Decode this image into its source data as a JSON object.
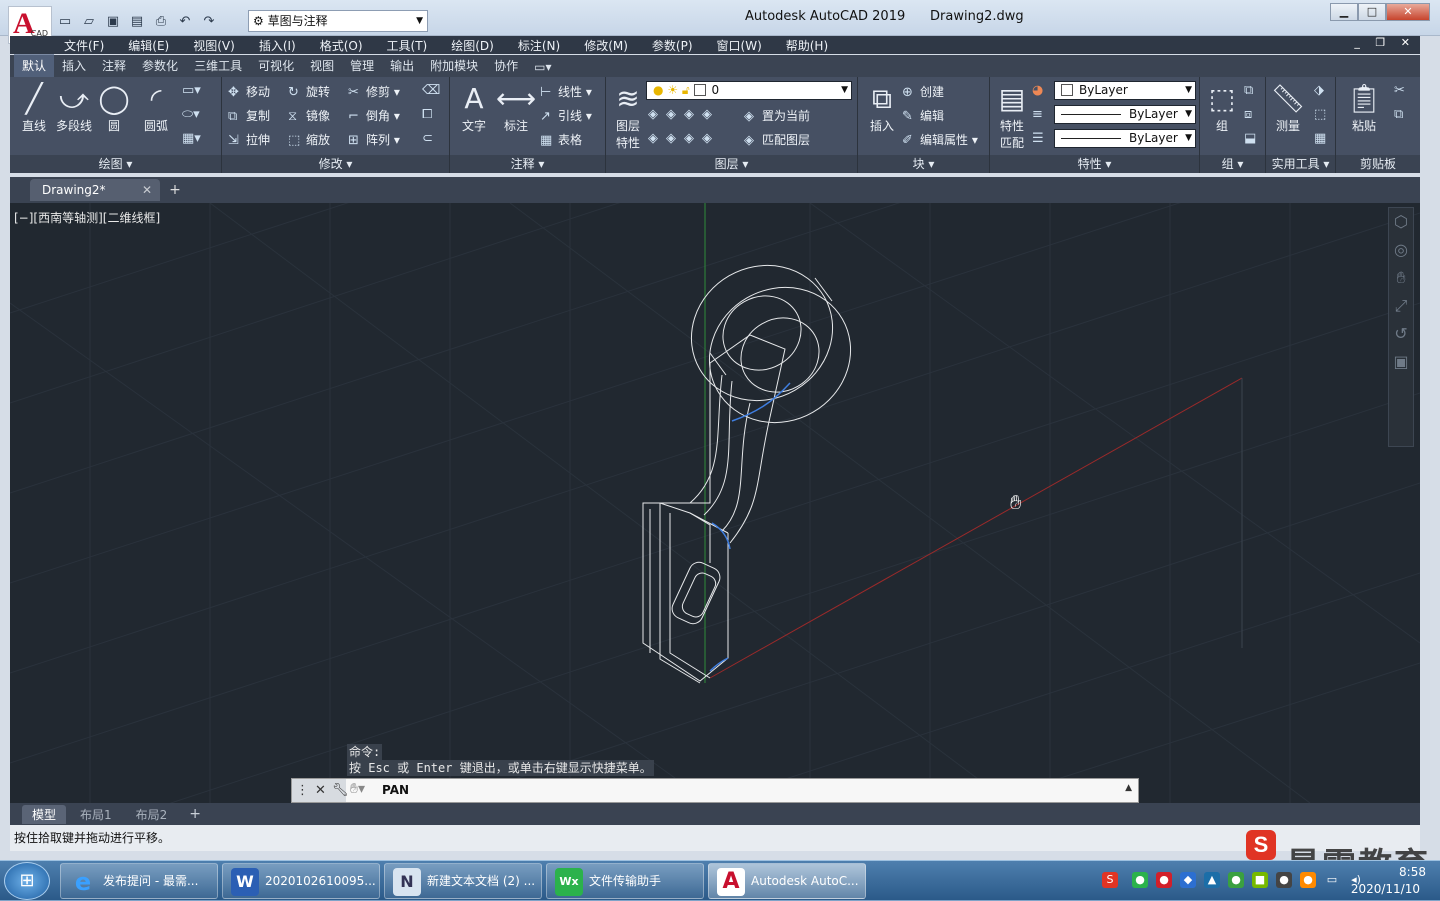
{
  "titlebar": {
    "title": "Autodesk AutoCAD 2019",
    "document": "Drawing2.dwg",
    "workspace": "草图与注释",
    "logo_letter": "A",
    "logo_sub": "CAD"
  },
  "menus": [
    "文件(F)",
    "编辑(E)",
    "视图(V)",
    "插入(I)",
    "格式(O)",
    "工具(T)",
    "绘图(D)",
    "标注(N)",
    "修改(M)",
    "参数(P)",
    "窗口(W)",
    "帮助(H)"
  ],
  "ribbon_tabs": [
    "默认",
    "插入",
    "注释",
    "参数化",
    "三维工具",
    "可视化",
    "视图",
    "管理",
    "输出",
    "附加模块",
    "协作"
  ],
  "ribbon": {
    "draw": {
      "title": "绘图",
      "line": "直线",
      "polyline": "多段线",
      "circle": "圆",
      "arc": "圆弧"
    },
    "modify": {
      "title": "修改",
      "move": "移动",
      "rotate": "旋转",
      "trim": "修剪",
      "copy": "复制",
      "mirror": "镜像",
      "fillet": "倒角",
      "stretch": "拉伸",
      "scale": "缩放",
      "array": "阵列"
    },
    "annotation": {
      "title": "注释",
      "text": "文字",
      "dimension": "标注",
      "linear": "线性",
      "leader": "引线",
      "table": "表格"
    },
    "layers": {
      "title": "图层",
      "layer_props_1": "图层",
      "layer_props_2": "特性",
      "layer_value": "0",
      "set_current": "置为当前",
      "match_layer": "匹配图层"
    },
    "block": {
      "title": "块",
      "insert": "插入",
      "create": "创建",
      "edit": "编辑",
      "edit_attr": "编辑属性"
    },
    "properties": {
      "title": "特性",
      "match_1": "特性",
      "match_2": "匹配",
      "color": "ByLayer",
      "linetype": "ByLayer",
      "lineweight": "ByLayer"
    },
    "groups": {
      "title": "组",
      "group": "组"
    },
    "utilities": {
      "title": "实用工具",
      "measure": "测量"
    },
    "clipboard": {
      "title": "剪贴板",
      "paste": "粘贴"
    }
  },
  "doc_tab": {
    "label": "Drawing2*"
  },
  "viewport": {
    "label": "[−][西南等轴测][二维线框]"
  },
  "command": {
    "history": [
      "命令:",
      "按 Esc 或 Enter 键退出，或单击右键显示快捷菜单。"
    ],
    "input": "PAN"
  },
  "layout_tabs": [
    "模型",
    "布局1",
    "布局2"
  ],
  "status": "按住拾取键并拖动进行平移。",
  "watermark": {
    "text": "最需教育",
    "badge": "S"
  },
  "taskbar": {
    "items": [
      {
        "label": "发布提问 - 最需...",
        "icon": "e"
      },
      {
        "label": "2020102610095...",
        "icon": "W"
      },
      {
        "label": "新建文本文档 (2) ...",
        "icon": "N"
      },
      {
        "label": "文件传输助手",
        "icon": "Wx"
      },
      {
        "label": "Autodesk AutoC...",
        "icon": "A"
      }
    ],
    "time": "8:58",
    "date": "2020/11/10"
  },
  "colors": {
    "viewport_bg": "#212830",
    "accent_red": "#c8102e",
    "axis_green": "#2e8b3a",
    "axis_red": "#9b2a2a",
    "highlight_blue": "#3f7ee0"
  }
}
